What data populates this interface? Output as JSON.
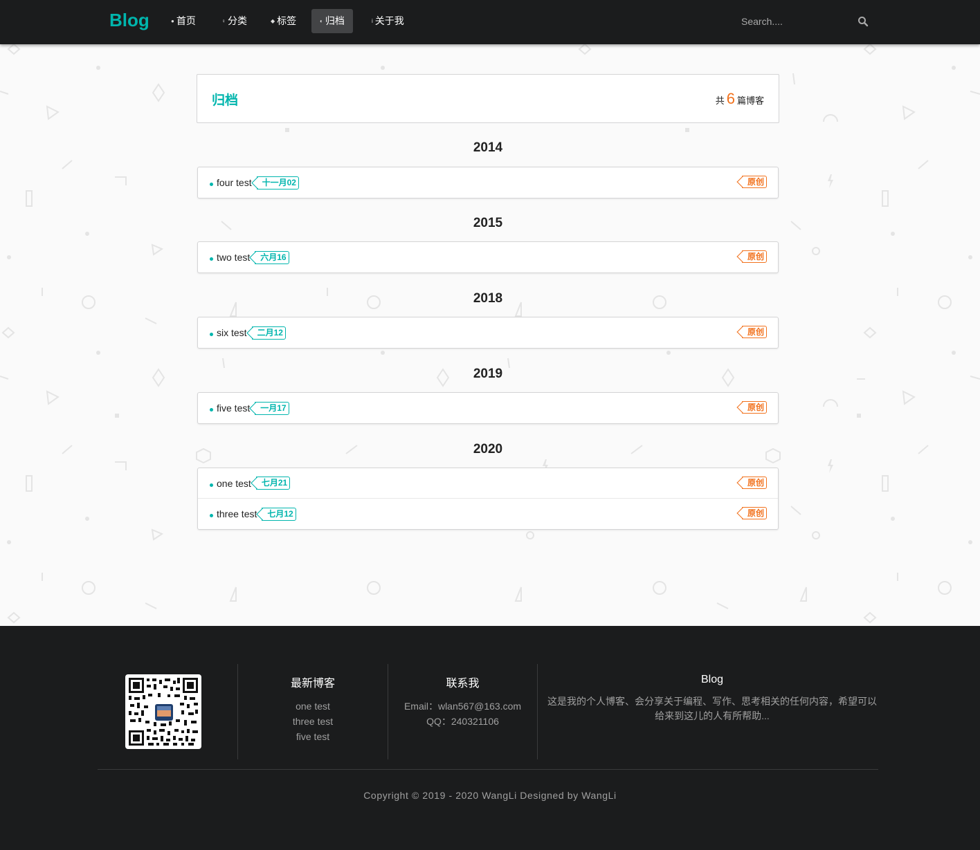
{
  "nav": {
    "brand": "Blog",
    "items": [
      {
        "label": "首页",
        "icon": "home-icon"
      },
      {
        "label": "分类",
        "icon": "idea-icon"
      },
      {
        "label": "标签",
        "icon": "tags-icon"
      },
      {
        "label": "归档",
        "icon": "clone-icon",
        "active": true
      },
      {
        "label": "关于我",
        "icon": "info-icon"
      }
    ],
    "search_placeholder": "Search...."
  },
  "archive": {
    "title": "归档",
    "count_prefix": "共",
    "count": "6",
    "count_suffix": "篇博客",
    "years": [
      {
        "year": "2014",
        "posts": [
          {
            "title": "four test",
            "date": "十一月02",
            "badge": "原创"
          }
        ]
      },
      {
        "year": "2015",
        "posts": [
          {
            "title": "two test",
            "date": "六月16",
            "badge": "原创"
          }
        ]
      },
      {
        "year": "2018",
        "posts": [
          {
            "title": "six test",
            "date": "二月12",
            "badge": "原创"
          }
        ]
      },
      {
        "year": "2019",
        "posts": [
          {
            "title": "five test",
            "date": "一月17",
            "badge": "原创"
          }
        ]
      },
      {
        "year": "2020",
        "posts": [
          {
            "title": "one test",
            "date": "七月21",
            "badge": "原创"
          },
          {
            "title": "three test",
            "date": "七月12",
            "badge": "原创"
          }
        ]
      }
    ]
  },
  "footer": {
    "latest": {
      "heading": "最新博客",
      "items": [
        "one test",
        "three test",
        "five test"
      ]
    },
    "contact": {
      "heading": "联系我",
      "email": "Email：wlan567@163.com",
      "qq": "QQ：240321106"
    },
    "about": {
      "heading": "Blog",
      "text": "这是我的个人博客、会分享关于编程、写作、思考相关的任何内容，希望可以给来到这儿的人有所帮助..."
    },
    "copyright": "Copyright © 2019 - 2020 WangLi Designed by WangLi"
  },
  "colors": {
    "accent": "#00b5ad",
    "orange": "#f2711c",
    "nav_bg": "#1b1c1d",
    "page_bg": "#fafafa"
  }
}
